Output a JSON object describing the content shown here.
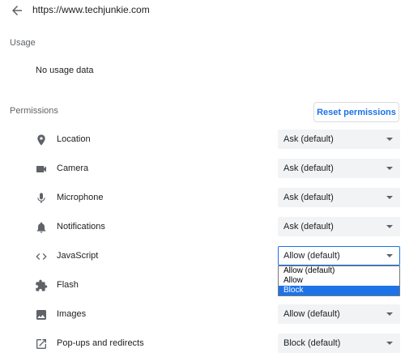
{
  "header": {
    "back_icon": "arrow-left-icon",
    "site_url": "https://www.techjunkie.com"
  },
  "usage": {
    "title": "Usage",
    "value": "No usage data"
  },
  "permissions": {
    "title": "Permissions",
    "reset_label": "Reset permissions",
    "items": [
      {
        "label": "Location",
        "icon": "location-pin-icon",
        "value": "Ask (default)"
      },
      {
        "label": "Camera",
        "icon": "camera-icon",
        "value": "Ask (default)"
      },
      {
        "label": "Microphone",
        "icon": "microphone-icon",
        "value": "Ask (default)"
      },
      {
        "label": "Notifications",
        "icon": "bell-icon",
        "value": "Ask (default)"
      },
      {
        "label": "JavaScript",
        "icon": "code-brackets-icon",
        "value": "Allow (default)"
      },
      {
        "label": "Flash",
        "icon": "puzzle-piece-icon",
        "value": ""
      },
      {
        "label": "Images",
        "icon": "image-icon",
        "value": "Allow (default)"
      },
      {
        "label": "Pop-ups and redirects",
        "icon": "open-in-new-icon",
        "value": "Block (default)"
      }
    ],
    "open_dropdown": {
      "options": [
        "Allow (default)",
        "Allow",
        "Block"
      ],
      "highlighted": "Block"
    }
  },
  "colors": {
    "accent": "#1a73e8",
    "select_background": "#f1f3f4",
    "icon": "#5f6368",
    "highlight": "#1e73e8"
  }
}
